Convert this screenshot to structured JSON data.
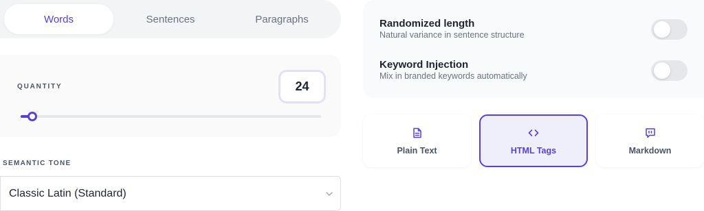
{
  "mode_tabs": [
    {
      "label": "Words",
      "active": true
    },
    {
      "label": "Sentences",
      "active": false
    },
    {
      "label": "Paragraphs",
      "active": false
    }
  ],
  "quantity": {
    "label": "QUANTITY",
    "value": "24",
    "slider_fraction": 0.04
  },
  "tone": {
    "label": "SEMANTIC TONE",
    "selected": "Classic Latin (Standard)"
  },
  "settings": [
    {
      "title": "Randomized length",
      "description": "Natural variance in sentence structure",
      "enabled": false
    },
    {
      "title": "Keyword Injection",
      "description": "Mix in branded keywords automatically",
      "enabled": false
    }
  ],
  "formats": [
    {
      "label": "Plain Text",
      "icon": "document-icon",
      "active": false
    },
    {
      "label": "HTML Tags",
      "icon": "code-brackets-icon",
      "active": true
    },
    {
      "label": "Markdown",
      "icon": "quote-bubble-icon",
      "active": false
    }
  ],
  "colors": {
    "accent": "#5b3fd6",
    "accent_bg": "#efeffc"
  }
}
